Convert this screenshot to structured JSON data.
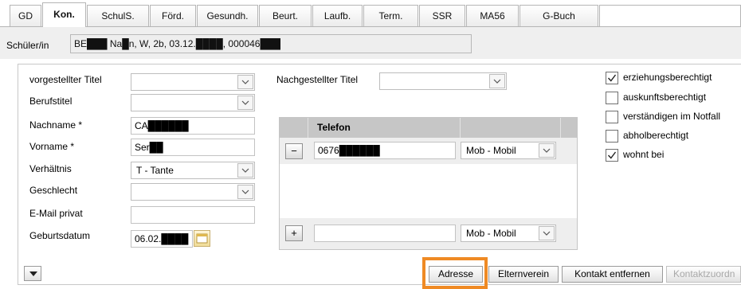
{
  "tabs": [
    {
      "label": "GD",
      "active": false
    },
    {
      "label": "Kon.",
      "active": true
    },
    {
      "label": "SchulS.",
      "active": false
    },
    {
      "label": "Förd.",
      "active": false
    },
    {
      "label": "Gesundh.",
      "active": false
    },
    {
      "label": "Beurt.",
      "active": false
    },
    {
      "label": "Laufb.",
      "active": false
    },
    {
      "label": "Term.",
      "active": false
    },
    {
      "label": "SSR",
      "active": false
    },
    {
      "label": "MA56",
      "active": false
    },
    {
      "label": "G-Buch",
      "active": false
    }
  ],
  "student": {
    "label": "Schüler/in",
    "value": "BE███ Na█n, W, 2b, 03.12.████, 000046███"
  },
  "form": {
    "vorgestellter_titel": {
      "label": "vorgestellter Titel",
      "value": ""
    },
    "berufstitel": {
      "label": "Berufstitel",
      "value": ""
    },
    "nachname": {
      "label": "Nachname *",
      "value": "CA██████"
    },
    "vorname": {
      "label": "Vorname *",
      "value": "Ser██"
    },
    "verhaeltnis": {
      "label": "Verhältnis",
      "value": "T - Tante"
    },
    "geschlecht": {
      "label": "Geschlecht",
      "value": ""
    },
    "email": {
      "label": "E-Mail privat",
      "value": ""
    },
    "geburtsdatum": {
      "label": "Geburtsdatum",
      "value": "06.02.████"
    },
    "nachgestellter_titel": {
      "label": "Nachgestellter Titel",
      "value": ""
    }
  },
  "phone_table": {
    "header": "Telefon",
    "rows": [
      {
        "number": "0676██████",
        "type": "Mob - Mobil",
        "action": "−"
      }
    ],
    "new_row": {
      "number": "",
      "type": "Mob - Mobil",
      "action": "+"
    }
  },
  "checkboxes": [
    {
      "label": "erziehungsberechtigt",
      "checked": true
    },
    {
      "label": "auskunftsberechtigt",
      "checked": false
    },
    {
      "label": "verständigen im Notfall",
      "checked": false
    },
    {
      "label": "abholberechtigt",
      "checked": false
    },
    {
      "label": "wohnt bei",
      "checked": true
    }
  ],
  "buttons": {
    "adresse": "Adresse",
    "elternverein": "Elternverein",
    "kontakt_entfernen": "Kontakt entfernen",
    "kontaktzuordnung": "Kontaktzuordn"
  },
  "colors": {
    "highlight": "#ef8a24",
    "table_header": "#c6c6c6"
  }
}
